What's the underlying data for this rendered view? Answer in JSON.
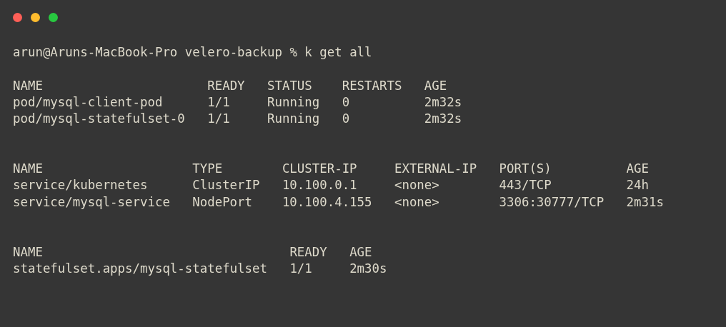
{
  "window": {
    "controls": [
      {
        "color": "#fe5f57"
      },
      {
        "color": "#febc2e"
      },
      {
        "color": "#28c840"
      }
    ]
  },
  "prompt": {
    "text": "arun@Aruns-MacBook-Pro velero-backup % k get all"
  },
  "tables": [
    {
      "columns": [
        "NAME",
        "READY",
        "STATUS",
        "RESTARTS",
        "AGE"
      ],
      "rows": [
        [
          "pod/mysql-client-pod",
          "1/1",
          "Running",
          "0",
          "2m32s"
        ],
        [
          "pod/mysql-statefulset-0",
          "1/1",
          "Running",
          "0",
          "2m32s"
        ]
      ]
    },
    {
      "columns": [
        "NAME",
        "TYPE",
        "CLUSTER-IP",
        "EXTERNAL-IP",
        "PORT(S)",
        "AGE"
      ],
      "rows": [
        [
          "service/kubernetes",
          "ClusterIP",
          "10.100.0.1",
          "<none>",
          "443/TCP",
          "24h"
        ],
        [
          "service/mysql-service",
          "NodePort",
          "10.100.4.155",
          "<none>",
          "3306:30777/TCP",
          "2m31s"
        ]
      ]
    },
    {
      "columns": [
        "NAME",
        "READY",
        "AGE"
      ],
      "rows": [
        [
          "statefulset.apps/mysql-statefulset",
          "1/1",
          "2m30s"
        ]
      ]
    }
  ]
}
